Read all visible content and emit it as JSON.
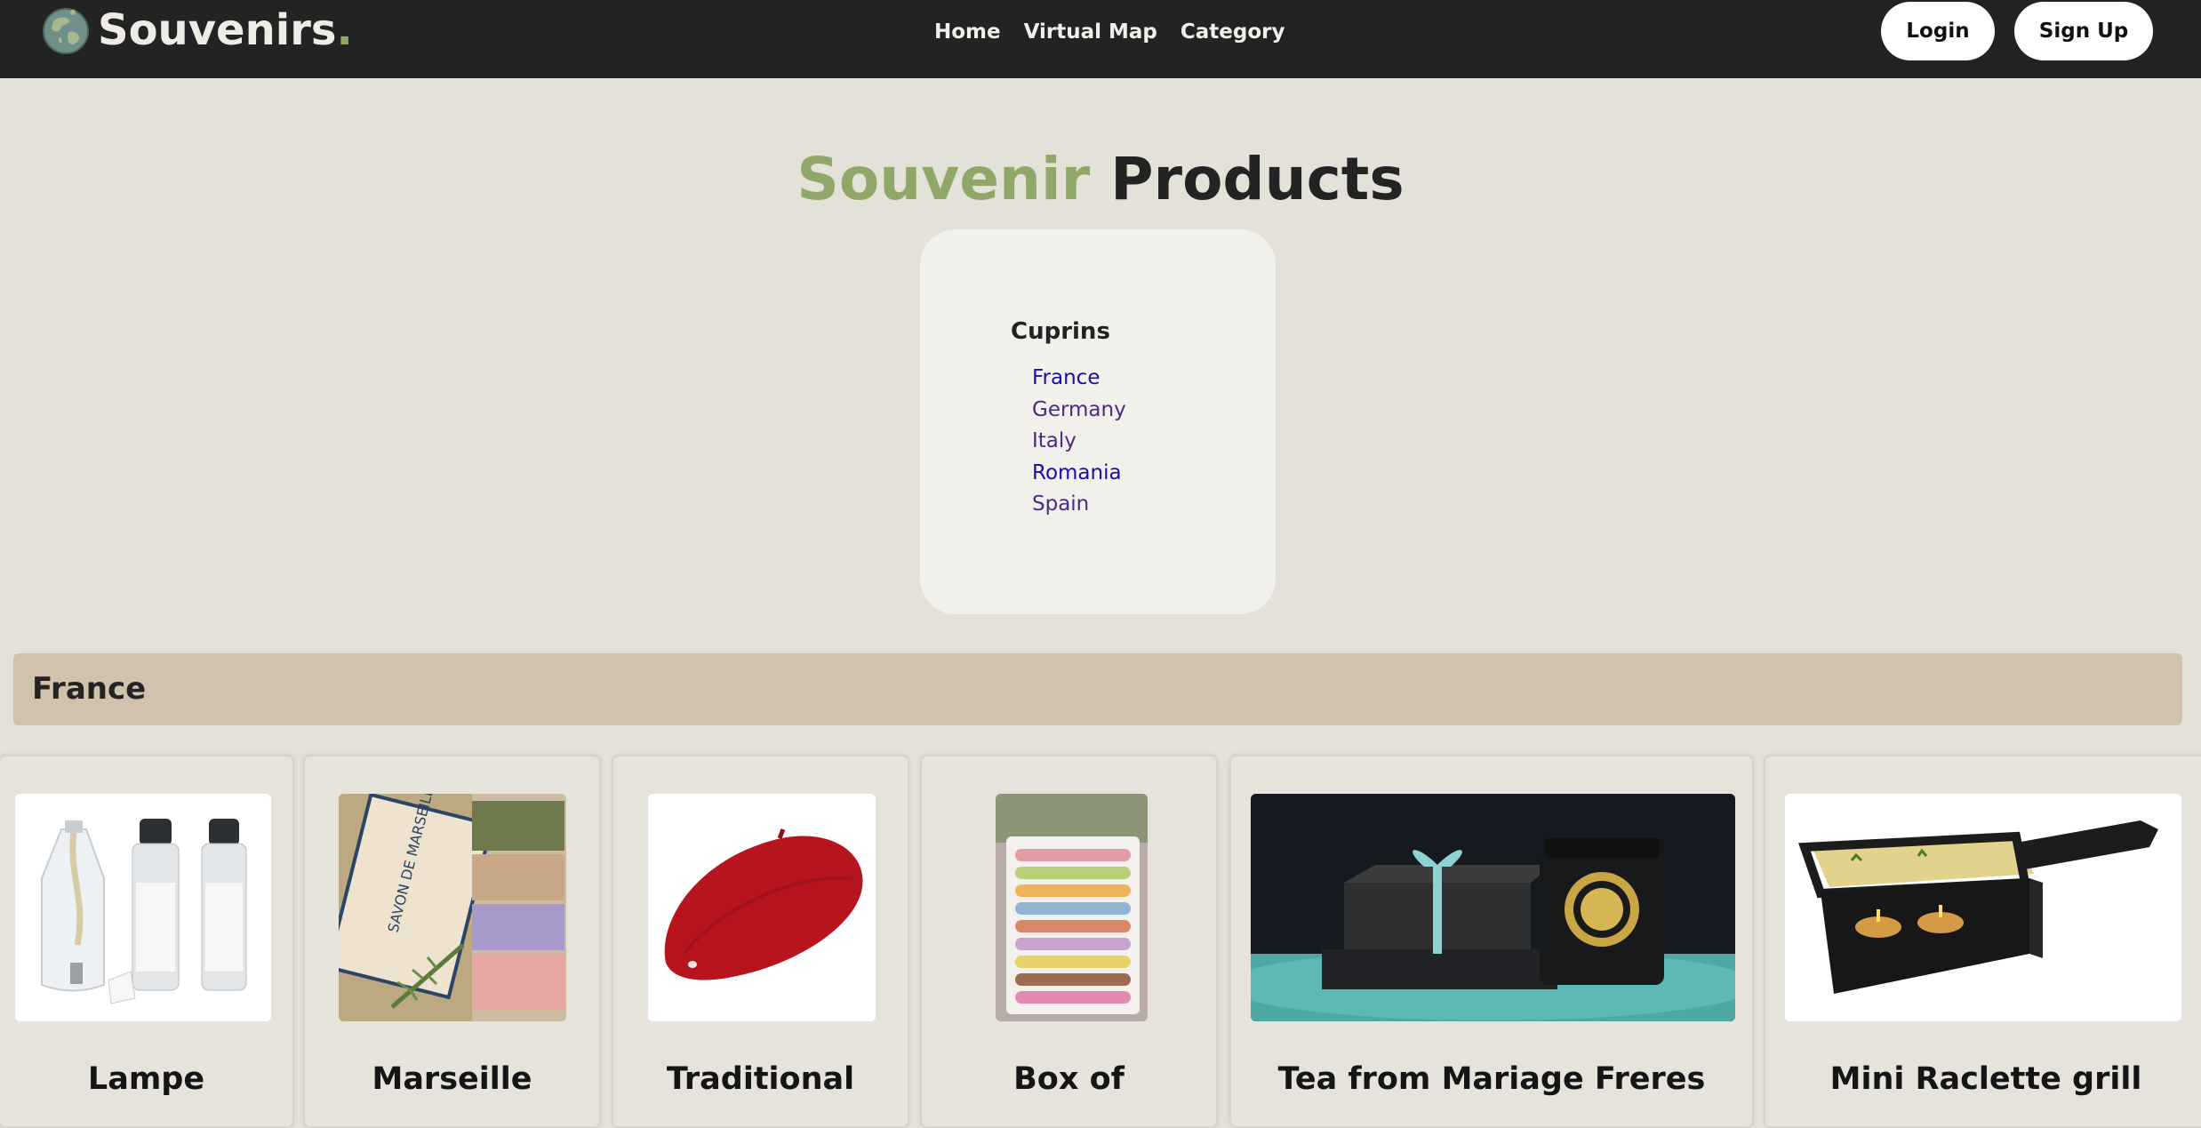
{
  "nav": {
    "brand": "Souvenirs",
    "brand_dot": ".",
    "links": [
      "Home",
      "Virtual Map",
      "Category"
    ],
    "login": "Login",
    "signup": "Sign Up"
  },
  "header": {
    "title_accent": "Souvenir",
    "title_main": "Products"
  },
  "countries": {
    "heading": "Cuprins",
    "items": [
      "France",
      "Germany",
      "Italy",
      "Romania",
      "Spain"
    ]
  },
  "section": {
    "title": "France"
  },
  "products": [
    {
      "title": "Lampe",
      "icon": "lampe-berger-bottles-image"
    },
    {
      "title": "Marseille",
      "icon": "marseille-soap-image"
    },
    {
      "title": "Traditional",
      "icon": "red-beret-image"
    },
    {
      "title": "Box of",
      "icon": "macarons-box-image"
    },
    {
      "title": "Tea from Mariage Freres",
      "icon": "tea-gift-box-image"
    },
    {
      "title": "Mini Raclette grill",
      "icon": "raclette-grill-image"
    }
  ],
  "colors": {
    "navbar": "#232323",
    "background": "#e4e1d9",
    "accent": "#8fa86a",
    "section_bar": "#d0c3ae",
    "link": "#1a0dab",
    "visited_link": "#4c2a83"
  }
}
